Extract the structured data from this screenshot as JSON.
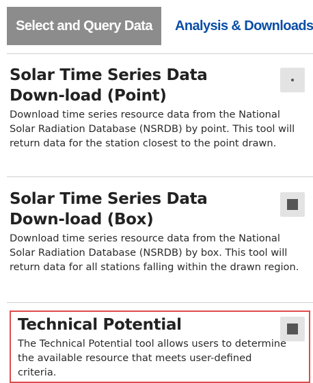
{
  "tabs": {
    "active_label": "Select and Query Data",
    "inactive_label": "Analysis & Downloads"
  },
  "tools": [
    {
      "title": "Solar Time Series Data Down-load (Point)",
      "description": "Download time series resource data from the National Solar Radiation Database (NSRDB) by point. This tool will return data for the station closest to the point drawn.",
      "icon": "point-icon"
    },
    {
      "title": "Solar Time Series Data Down-load (Box)",
      "description": "Download time series resource data from the National Solar Radiation Database (NSRDB) by box. This tool will return data for all stations falling within the drawn region.",
      "icon": "square-icon"
    },
    {
      "title": "Technical Potential",
      "description": "The Technical Potential tool allows users to determine the available resource that meets user-defined criteria.",
      "icon": "square-icon"
    }
  ],
  "colors": {
    "active_tab_bg": "#8c8c8c",
    "inactive_tab_text": "#0a4ea6",
    "highlight_border": "#e04a4a",
    "tool_button_bg": "#e3e3e3"
  }
}
